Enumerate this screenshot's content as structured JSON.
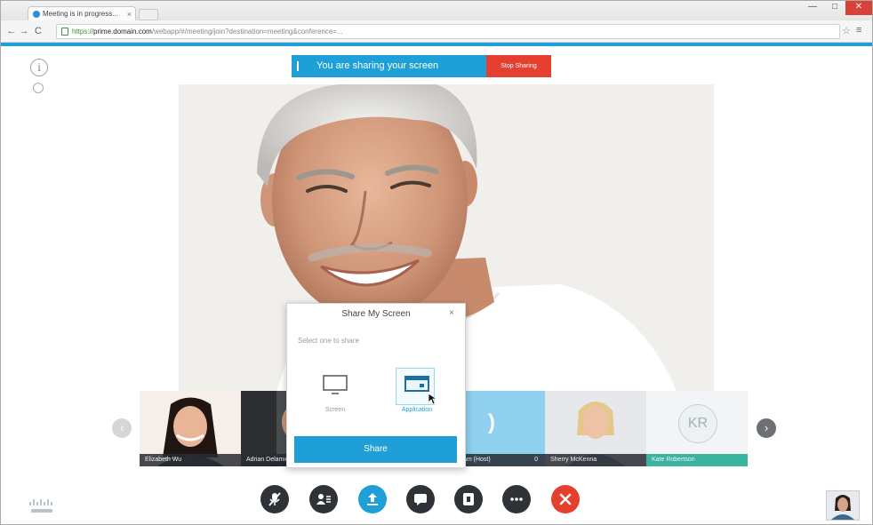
{
  "browser": {
    "tab_title": "Meeting is in progress...",
    "tab_close": "×",
    "url_https": "https://",
    "url_host": "prime.domain.com",
    "url_rest": "/webapp/#/meeting/join?destination=meeting&conference=...",
    "window_controls": {
      "minimize": "—",
      "maximize": "□",
      "close": "✕"
    }
  },
  "banner": {
    "text": "You are sharing your screen",
    "stop_label": "Stop Sharing"
  },
  "dialog": {
    "title": "Share My Screen",
    "close": "×",
    "subtitle": "Select one to share",
    "options": [
      {
        "label": "Screen",
        "icon": "monitor-icon",
        "selected": false
      },
      {
        "label": "Application",
        "icon": "application-window-icon",
        "selected": true
      }
    ],
    "share_label": "Share"
  },
  "participants": [
    {
      "name": "Elizabeth Wu"
    },
    {
      "name": "Adrian Delamico"
    },
    {
      "name": ""
    },
    {
      "name": "Ed Liam (Host)",
      "suffix": "0",
      "speaking": true
    },
    {
      "name": "Sherry McKenna"
    },
    {
      "name": "Kate Robertson",
      "initials": "KR"
    }
  ],
  "controls": [
    {
      "name": "mute",
      "icon": "microphone-muted-icon"
    },
    {
      "name": "participants",
      "icon": "participants-icon"
    },
    {
      "name": "share",
      "icon": "share-upload-icon"
    },
    {
      "name": "chat",
      "icon": "chat-bubble-icon"
    },
    {
      "name": "layout",
      "icon": "layout-icon"
    },
    {
      "name": "more",
      "icon": "more-icon"
    },
    {
      "name": "leave",
      "icon": "leave-x-icon"
    }
  ],
  "colors": {
    "accent": "#1e9fd8",
    "stop_red": "#e5402f",
    "control_dark": "#2f3237",
    "host_tile": "#8fd0ee",
    "active_name_bar": "#3bb3a1"
  }
}
